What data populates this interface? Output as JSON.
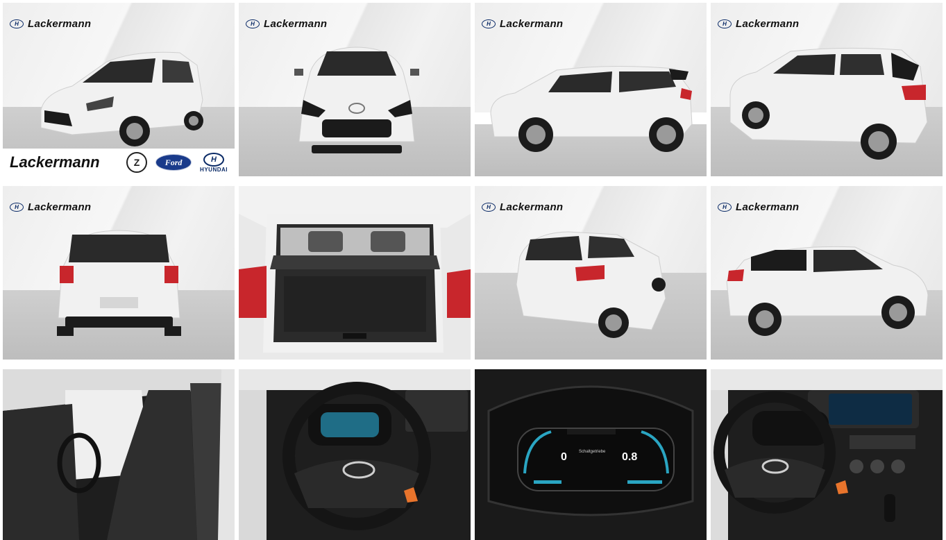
{
  "gallery": {
    "dealer_brand": "Lackermann",
    "banner": {
      "text": "Lackermann",
      "logos": {
        "opel": "Z",
        "ford": "Ford",
        "hyundai_mark": "H",
        "hyundai_word": "HYUNDAI"
      }
    },
    "hyundai_mark": "H",
    "cluster": {
      "speed": "0",
      "range": "0.8",
      "mode": "Schaltgetriebe"
    },
    "colors": {
      "car_white": "#f1f1f1",
      "trim_black": "#1b1b1b",
      "tail_red": "#c8262c",
      "brand_navy": "#0a2a66",
      "ford_blue": "#1a3b8b"
    },
    "tiles": [
      {
        "view": "front-left three-quarter",
        "icon": "car-photo"
      },
      {
        "view": "front",
        "icon": "car-photo"
      },
      {
        "view": "left side",
        "icon": "car-photo"
      },
      {
        "view": "rear-left three-quarter",
        "icon": "car-photo"
      },
      {
        "view": "rear",
        "icon": "car-photo"
      },
      {
        "view": "open trunk",
        "icon": "car-photo"
      },
      {
        "view": "rear-right three-quarter",
        "icon": "car-photo"
      },
      {
        "view": "right side",
        "icon": "car-photo"
      },
      {
        "view": "front seats",
        "icon": "car-photo"
      },
      {
        "view": "steering wheel",
        "icon": "car-photo"
      },
      {
        "view": "instrument cluster",
        "icon": "car-photo"
      },
      {
        "view": "dashboard",
        "icon": "car-photo"
      }
    ]
  }
}
